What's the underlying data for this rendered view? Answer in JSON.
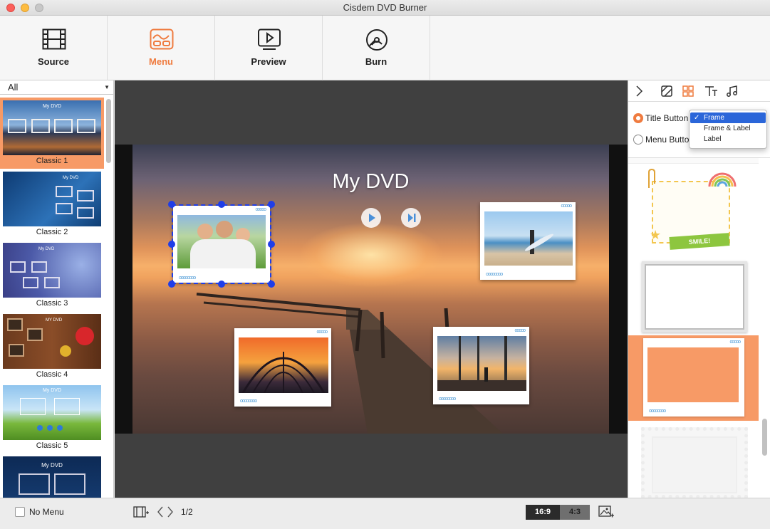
{
  "window": {
    "title": "Cisdem DVD Burner"
  },
  "toolbar": {
    "tabs": [
      {
        "label": "Source",
        "icon": "film-icon"
      },
      {
        "label": "Menu",
        "icon": "menu-icon",
        "active": true
      },
      {
        "label": "Preview",
        "icon": "preview-icon"
      },
      {
        "label": "Burn",
        "icon": "burn-icon"
      }
    ],
    "accent": "#ef7b3f"
  },
  "templates": {
    "filter": "All",
    "items": [
      {
        "label": "Classic 1",
        "selected": true
      },
      {
        "label": "Classic 2"
      },
      {
        "label": "Classic 3"
      },
      {
        "label": "Classic 4"
      },
      {
        "label": "Classic 5"
      },
      {
        "label": "My DVD"
      }
    ],
    "thumb_titles": [
      "My DVD",
      "My DVD",
      "My DVD",
      "MY DVD",
      "My DVD"
    ]
  },
  "preview": {
    "title": "My DVD",
    "dots": "oooooooo",
    "small_dots": "ooooo"
  },
  "design_panel": {
    "radio_title": "Title Button",
    "radio_menu": "Menu Button",
    "dropdown": {
      "options": [
        "Frame",
        "Frame & Label",
        "Label"
      ],
      "selected": "Frame"
    },
    "sticker_text": "SMILE!"
  },
  "bottom_bar": {
    "no_menu_label": "No Menu",
    "page": "1/2",
    "ratio_wide": "16:9",
    "ratio_std": "4:3",
    "ratio_active": "16:9"
  }
}
